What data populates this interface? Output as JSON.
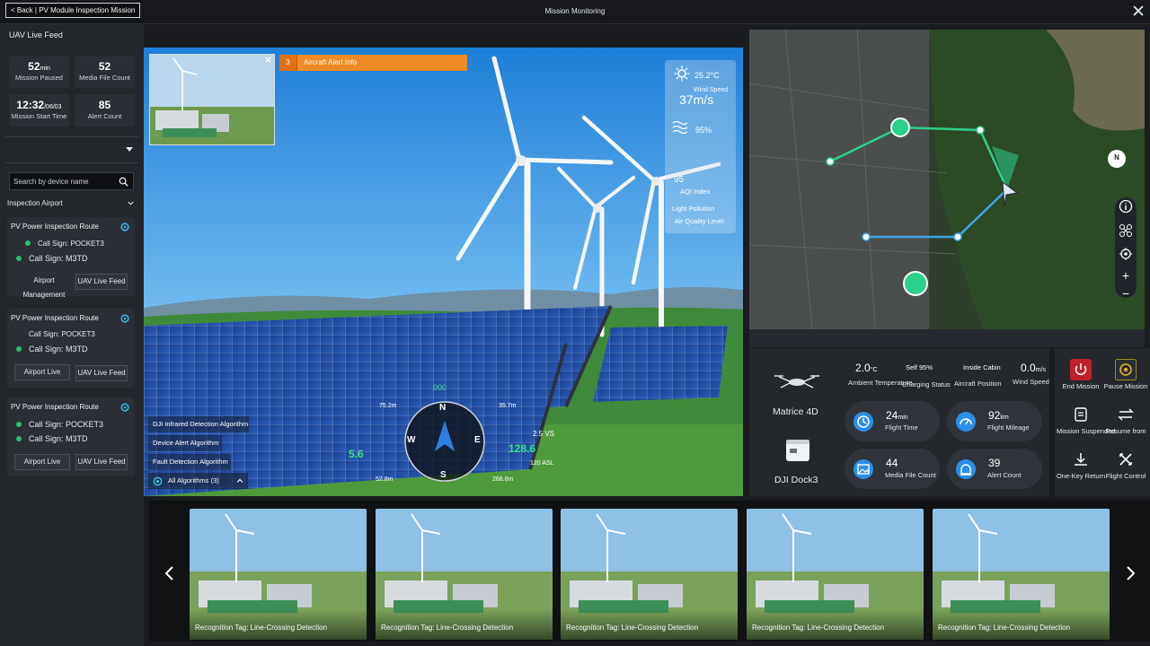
{
  "topbar": {
    "back_label": "< Back | PV Module Inspection Mission",
    "title": "Mission Monitoring"
  },
  "left": {
    "title": "UAV Live Feed",
    "stats": [
      {
        "value": "52",
        "unit": "min",
        "label": "Mission Paused"
      },
      {
        "value": "52",
        "unit": "",
        "label": "Media File Count"
      },
      {
        "value": "12:32",
        "unit": "/06/03",
        "label": "Mission Start Time"
      },
      {
        "value": "85",
        "unit": "",
        "label": "Alert Count"
      }
    ],
    "search_placeholder": "Search by device name",
    "airport_header": "Inspection Airport",
    "routes": [
      {
        "title": "PV Power Inspection Route",
        "sign1": "Call Sign: POCKET3",
        "sign2": "Call Sign: M3TD",
        "btn1": "Airport Management",
        "btn2": "UAV Live Feed"
      },
      {
        "title": "PV Power Inspection Route",
        "sign1": "Call Sign: POCKET3",
        "sign2": "Call Sign: M3TD",
        "btn1": "Airport Live",
        "btn2": "UAV Live Feed"
      },
      {
        "title": "PV Power Inspection Route",
        "sign1": "Call Sign: POCKET3",
        "sign2": "Call Sign: M3TD",
        "btn1": "Airport Live",
        "btn2": "UAV Live Feed"
      }
    ]
  },
  "video": {
    "alert_count": "3",
    "alert_label": "Aircraft Alert Info",
    "weather": {
      "temp": "25.2°C",
      "wind_label": "Wind Speed",
      "wind": "37m/s",
      "humidity": "95%",
      "aqi": "95",
      "aqi_label": "AQI Index",
      "light_pollution": "Light Pollution",
      "air_quality": "Air Quality Level"
    },
    "algorithms": [
      "DJI Infrared Detection Algorithm",
      "Device Alert Algorithm",
      "Fault Detection Algorithm"
    ],
    "all_algorithms": "All Algorithms (3)",
    "hud": {
      "heading": "000",
      "left_small": "75.2m",
      "right_small": "35.7m",
      "left_big": "5.6",
      "right_big": "128.6",
      "vs": "2.5 VS",
      "asl": "120 ASL",
      "left_bottom": "52.8m",
      "right_bottom": "268.8m",
      "compass": {
        "n": "N",
        "e": "E",
        "s": "S",
        "w": "W"
      }
    }
  },
  "map": {
    "compass_label": "N",
    "zoom_in": "+",
    "zoom_out": "−"
  },
  "telemetry": {
    "aircraft_model": "Matrice 4D",
    "dock_model": "DJI Dock3",
    "ambient_temp": "2.0",
    "ambient_unit": "°C",
    "ambient_label": "Ambient Temperature",
    "charging_value": "Self 95%",
    "charging_label": "Charging Status",
    "position_value": "Inside Cabin",
    "position_label": "Aircraft Position",
    "wind_value": "0.0",
    "wind_unit": "m/s",
    "wind_label": "Wind Speed",
    "cards": [
      {
        "value": "24",
        "unit": "min",
        "label": "Flight Time"
      },
      {
        "value": "92",
        "unit": "km",
        "label": "Flight Mileage"
      },
      {
        "value": "44",
        "unit": "",
        "label": "Media File Count"
      },
      {
        "value": "39",
        "unit": "",
        "label": "Alert Count"
      }
    ]
  },
  "controls": [
    {
      "label": "End Mission",
      "icon": "power-icon",
      "color": "#c0202a"
    },
    {
      "label": "Pause Mission",
      "icon": "pause-circle-icon",
      "color": "#c9a623"
    },
    {
      "label": "Mission Suspended",
      "icon": "clipboard-icon",
      "color": "#3a3f46"
    },
    {
      "label": "Resume from",
      "icon": "switch-icon",
      "color": "#3a3f46"
    },
    {
      "label": "One-Key Return",
      "icon": "return-icon",
      "color": "#3a3f46"
    },
    {
      "label": "Flight Control",
      "icon": "crossed-arrows-icon",
      "color": "#3a3f46"
    }
  ],
  "gallery": {
    "captions": [
      "Recognition Tag: Line-Crossing Detection",
      "Recognition Tag: Line-Crossing Detection",
      "Recognition Tag: Line-Crossing Detection",
      "Recognition Tag: Line-Crossing Detection",
      "Recognition Tag: Line-Crossing Detection"
    ]
  }
}
